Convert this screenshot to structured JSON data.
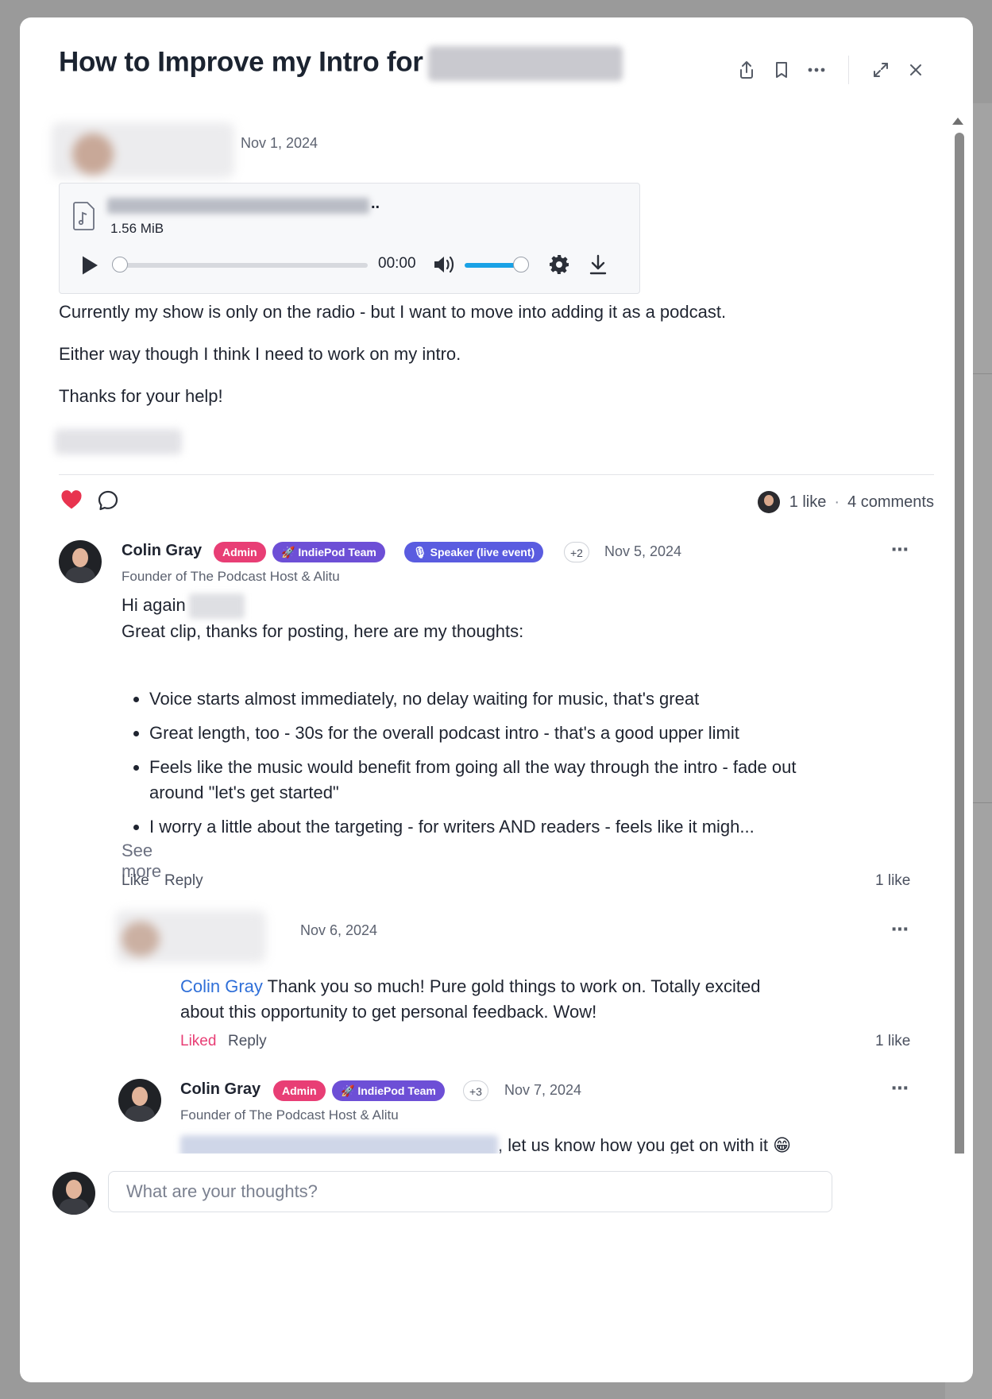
{
  "post": {
    "title": "How to Improve my Intro for",
    "date": "Nov 1, 2024",
    "paragraphs": [
      "Currently my show is only on the radio - but I want to move into adding it as a podcast.",
      "Either way though I think I need to work on my intro.",
      "Thanks for your help!"
    ]
  },
  "header_icons": [
    "share-icon",
    "bookmark-icon",
    "more-icon",
    "expand-icon",
    "close-icon"
  ],
  "audio": {
    "file_dots": "..",
    "file_size": "1.56 MiB",
    "time": "00:00",
    "progress": 0,
    "volume": 0.85
  },
  "stats": {
    "likes": "1 like",
    "separator": "·",
    "comments": "4 comments"
  },
  "comments": [
    {
      "name": "Colin Gray",
      "badges": [
        "Admin",
        "🚀 IndiePod Team",
        "🎙 Speaker (live event)",
        "+2"
      ],
      "date": "Nov 5, 2024",
      "subtitle": "Founder of The Podcast Host & Alitu",
      "greeting": "Hi again",
      "intro": "Great clip, thanks for posting, here are my thoughts:",
      "points": [
        "Voice starts almost immediately, no delay waiting for music, that's great",
        "Great length, too - 30s for the overall podcast intro - that's a good upper limit",
        "Feels like the music would benefit from going all the way through the intro - fade out around \"let's get started\"",
        "I worry a little about the targeting - for writers AND readers - feels like it migh..."
      ],
      "see_more": "See more",
      "like_label": "Like",
      "reply_label": "Reply",
      "likes": "1 like"
    },
    {
      "date": "Nov 6, 2024",
      "mention": "Colin Gray",
      "text_line1": "Thank you so much! Pure gold things to work on. Totally excited",
      "text_line2": "about this opportunity to get personal feedback. Wow!",
      "liked_label": "Liked",
      "reply_label": "Reply",
      "likes": "1 like"
    },
    {
      "name": "Colin Gray",
      "badges": [
        "Admin",
        "🚀 IndiePod Team",
        "+3"
      ],
      "date": "Nov 7, 2024",
      "subtitle": "Founder of The Podcast Host & Alitu",
      "text": ", let us know how you get on with it 😁"
    }
  ],
  "input": {
    "placeholder": "What are your thoughts?"
  },
  "colors": {
    "admin_badge": "#e83e75",
    "team_badge": "#6d4fd6",
    "speaker_badge": "#5a5ce0",
    "heart": "#e8334f",
    "mention": "#2f6fd8",
    "volume": "#1aa2e6"
  }
}
